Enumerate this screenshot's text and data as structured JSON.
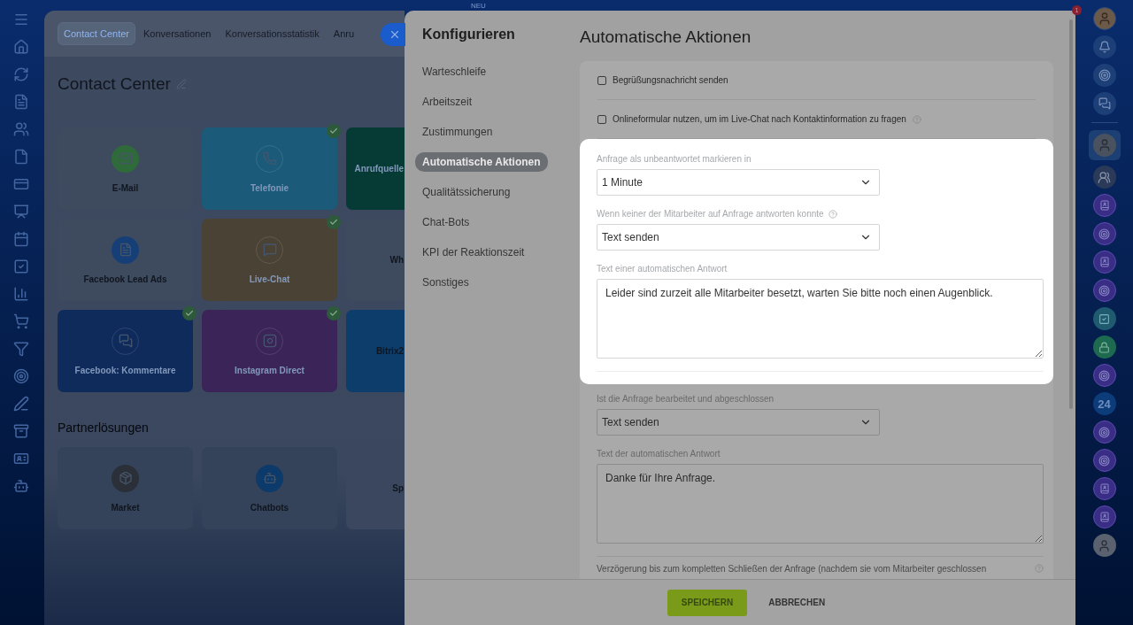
{
  "top_bar": {
    "badge": "NEU"
  },
  "background_page": {
    "tabs": [
      {
        "label": "Contact Center",
        "selected": true
      },
      {
        "label": "Konversationen",
        "selected": false
      },
      {
        "label": "Konversationsstatistik",
        "selected": false
      },
      {
        "label": "Anru",
        "selected": false
      }
    ],
    "title": "Contact Center",
    "tiles": [
      {
        "label": "E-Mail",
        "kind": "mail",
        "connected": false,
        "color": "#2f6b3a"
      },
      {
        "label": "Telefonie",
        "kind": "phone",
        "connected": true,
        "color": "#1b5a79"
      },
      {
        "label": "Anrufquelle",
        "kind": "none",
        "color": "#053a35"
      },
      {
        "label": "Facebook Lead Ads",
        "kind": "lead",
        "connected": false,
        "color": "#163f78"
      },
      {
        "label": "Live-Chat",
        "kind": "chat",
        "connected": true,
        "color": "#4b4236"
      },
      {
        "label": "Wh",
        "kind": "none",
        "color": "#3e4a5e"
      },
      {
        "label": "Facebook: Kommentare",
        "kind": "comments",
        "connected": true,
        "color": "#0f2b5c"
      },
      {
        "label": "Instagram Direct",
        "kind": "instagram",
        "connected": true,
        "color": "#3b2558"
      },
      {
        "label": "Bitrix2",
        "kind": "none",
        "color": "#0d3d6b"
      }
    ],
    "partner_title": "Partnerlösungen",
    "partner_tiles": [
      {
        "label": "Market",
        "kind": "market",
        "color": "#2a2f38"
      },
      {
        "label": "Chatbots",
        "kind": "bot",
        "color": "#0c3a6a"
      },
      {
        "label": "Sp",
        "kind": "none",
        "color": "#3a475e"
      }
    ]
  },
  "panel": {
    "nav_title": "Konfigurieren",
    "nav_items": [
      {
        "label": "Warteschleife",
        "selected": false
      },
      {
        "label": "Arbeitszeit",
        "selected": false
      },
      {
        "label": "Zustimmungen",
        "selected": false
      },
      {
        "label": "Automatische Aktionen",
        "selected": true
      },
      {
        "label": "Qualitätssicherung",
        "selected": false
      },
      {
        "label": "Chat-Bots",
        "selected": false
      },
      {
        "label": "KPI der Reaktionszeit",
        "selected": false
      },
      {
        "label": "Sonstiges",
        "selected": false
      }
    ],
    "title": "Automatische Aktionen",
    "checkboxes": [
      {
        "label": "Begrüßungsnachricht senden",
        "checked": false
      },
      {
        "label": "Onlineformular nutzen, um im Live-Chat nach Kontaktinformation zu fragen",
        "checked": false,
        "help": true
      }
    ],
    "sections": [
      {
        "highlighted": true,
        "fields": [
          {
            "kind": "select",
            "label": "Anfrage als unbeantwortet markieren in",
            "value": "1 Minute"
          },
          {
            "kind": "select",
            "label": "Wenn keiner der Mitarbeiter auf Anfrage antworten konnte",
            "value": "Text senden",
            "help": true
          },
          {
            "kind": "textarea",
            "label": "Text einer automatischen Antwort",
            "value": "Leider sind zurzeit alle Mitarbeiter besetzt, warten Sie bitte noch einen Augenblick."
          }
        ]
      },
      {
        "highlighted": false,
        "fields": [
          {
            "kind": "select",
            "label": "Ist die Anfrage bearbeitet und abgeschlossen",
            "value": "Text senden"
          },
          {
            "kind": "textarea",
            "label": "Text der automatischen Antwort",
            "value": "Danke für Ihre Anfrage."
          },
          {
            "kind": "label",
            "label": "Verzögerung bis zum kompletten Schließen der Anfrage (nachdem sie vom Mitarbeiter geschlossen",
            "help": true
          }
        ]
      }
    ],
    "footer_buttons": [
      {
        "label": "SPEICHERN",
        "kind": "primary"
      },
      {
        "label": "ABBRECHEN",
        "kind": "link"
      }
    ]
  },
  "right_rail": {
    "notification_count": "1",
    "items": [
      {
        "kind": "avatar"
      },
      {
        "kind": "bell"
      },
      {
        "kind": "target"
      },
      {
        "kind": "exchange"
      },
      {
        "kind": "divider"
      },
      {
        "kind": "person"
      },
      {
        "kind": "group"
      },
      {
        "kind": "book"
      },
      {
        "kind": "target-app"
      },
      {
        "kind": "book"
      },
      {
        "kind": "target-app"
      },
      {
        "kind": "check"
      },
      {
        "kind": "lock"
      },
      {
        "kind": "target-app"
      },
      {
        "kind": "text",
        "text": "24"
      },
      {
        "kind": "target-app"
      },
      {
        "kind": "target-app"
      },
      {
        "kind": "book"
      },
      {
        "kind": "book"
      },
      {
        "kind": "cat"
      }
    ]
  }
}
